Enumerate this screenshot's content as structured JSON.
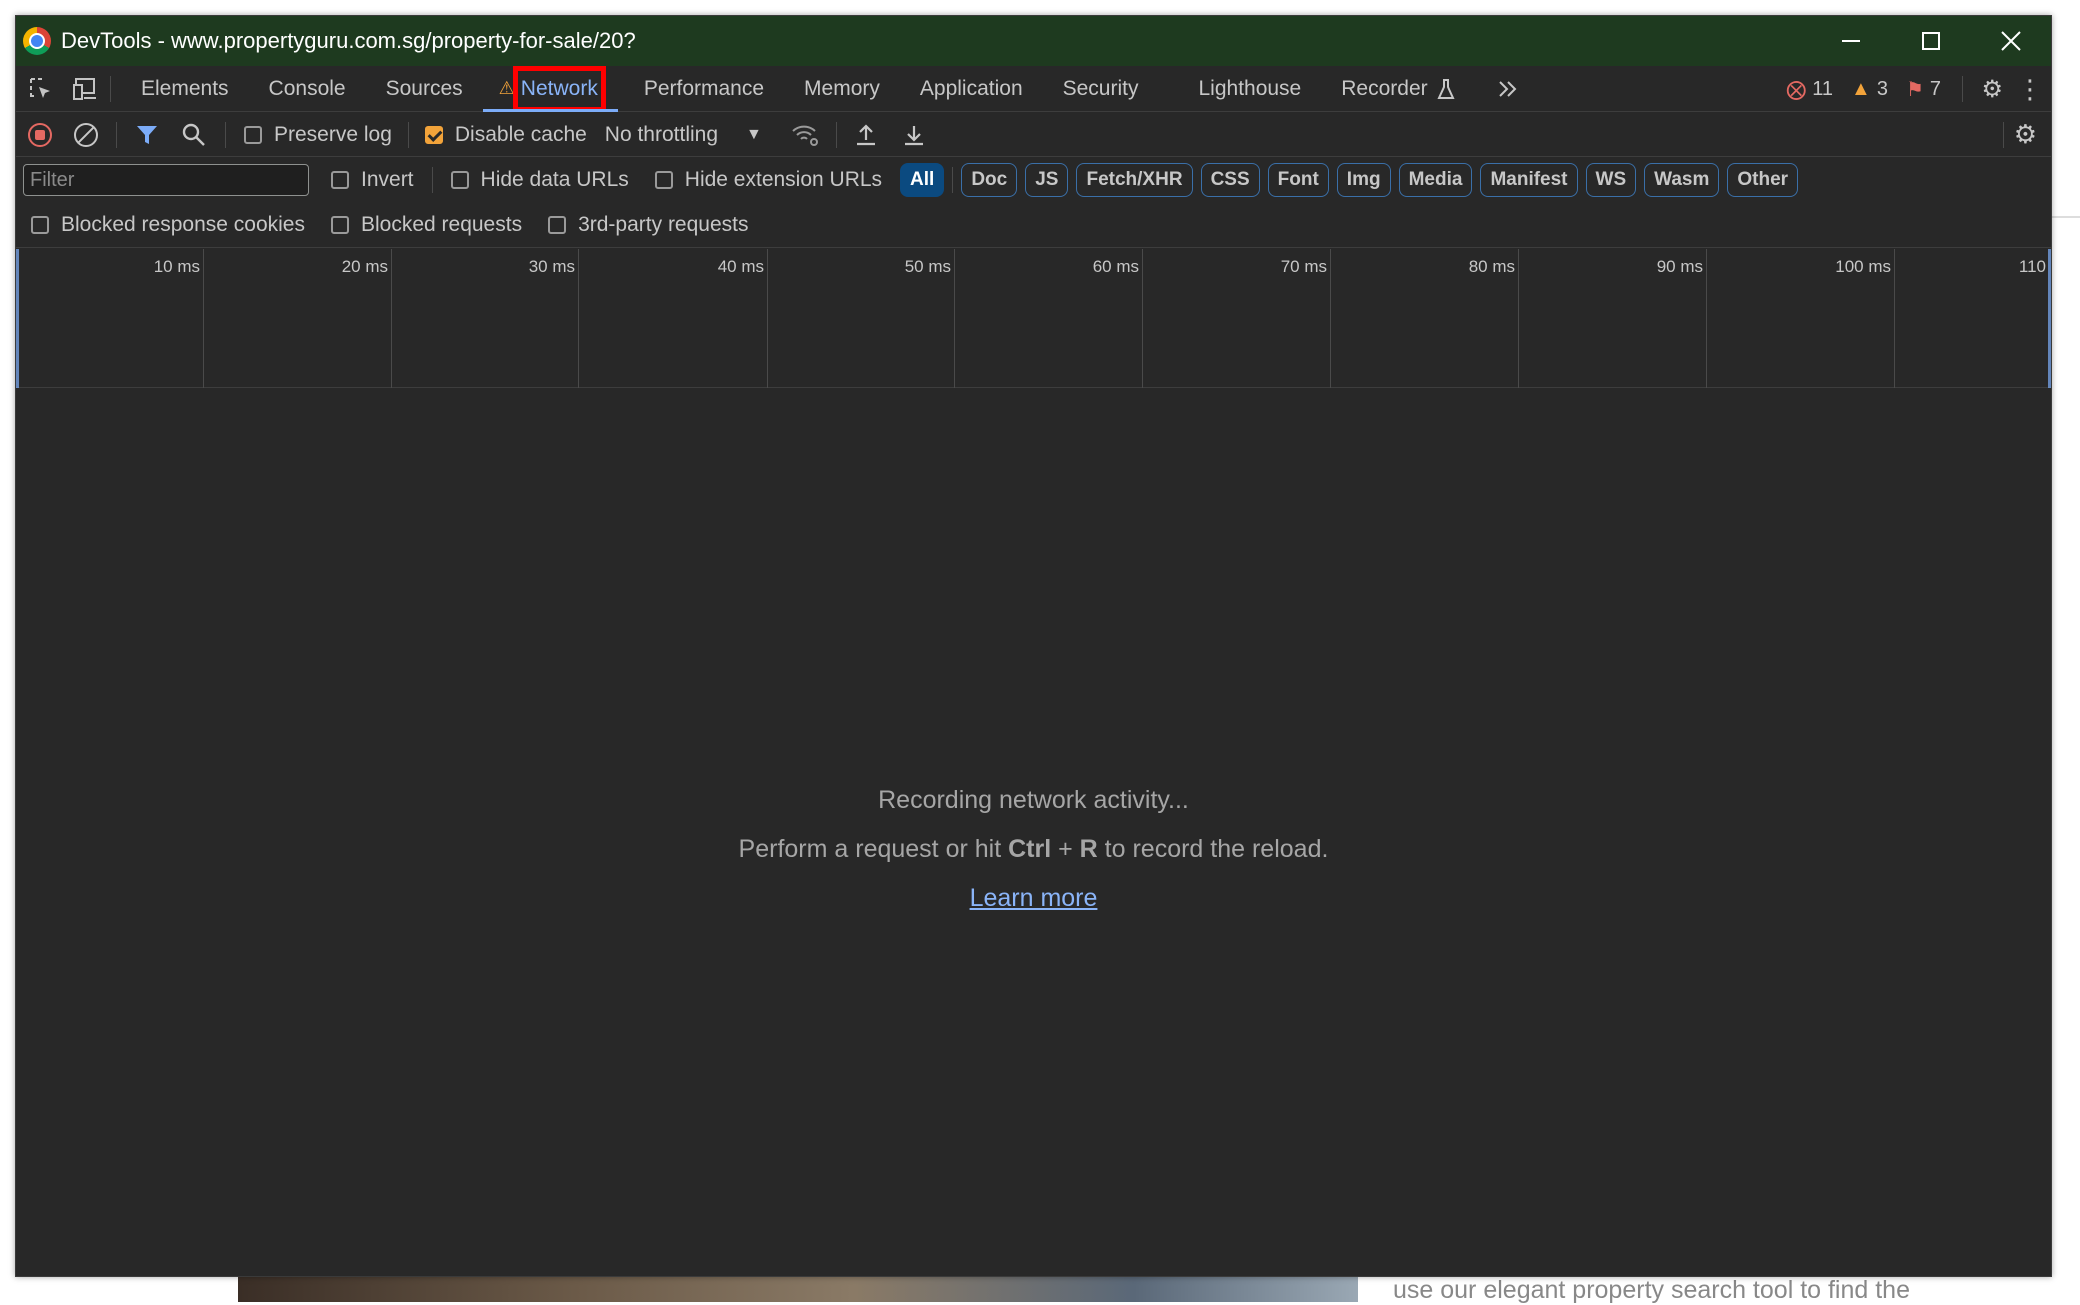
{
  "background": {
    "snippet_text": "use our elegant property search tool to find the"
  },
  "window": {
    "title": "DevTools - www.propertyguru.com.sg/property-for-sale/20?"
  },
  "tabs": [
    {
      "label": "Elements",
      "active": false
    },
    {
      "label": "Console",
      "active": false
    },
    {
      "label": "Sources",
      "active": false
    },
    {
      "label": "Network",
      "active": true,
      "has_warning": true
    },
    {
      "label": "Performance",
      "active": false
    },
    {
      "label": "Memory",
      "active": false
    },
    {
      "label": "Application",
      "active": false
    },
    {
      "label": "Security",
      "active": false
    },
    {
      "label": "Lighthouse",
      "active": false
    },
    {
      "label": "Recorder",
      "active": false
    }
  ],
  "status_counts": {
    "errors": "11",
    "warnings": "3",
    "issues": "7"
  },
  "toolbar": {
    "preserve_log_label": "Preserve log",
    "preserve_log_checked": false,
    "disable_cache_label": "Disable cache",
    "disable_cache_checked": true,
    "throttling_value": "No throttling"
  },
  "filterbar": {
    "filter_placeholder": "Filter",
    "invert_label": "Invert",
    "hide_data_urls_label": "Hide data URLs",
    "hide_extension_urls_label": "Hide extension URLs",
    "chips": [
      "All",
      "Doc",
      "JS",
      "Fetch/XHR",
      "CSS",
      "Font",
      "Img",
      "Media",
      "Manifest",
      "WS",
      "Wasm",
      "Other"
    ],
    "active_chip": "All"
  },
  "options": {
    "blocked_cookies_label": "Blocked response cookies",
    "blocked_requests_label": "Blocked requests",
    "third_party_label": "3rd-party requests"
  },
  "timeline": {
    "ticks": [
      "10 ms",
      "20 ms",
      "30 ms",
      "40 ms",
      "50 ms",
      "60 ms",
      "70 ms",
      "80 ms",
      "90 ms",
      "100 ms",
      "110"
    ]
  },
  "empty_state": {
    "line1": "Recording network activity...",
    "line2_prefix": "Perform a request or hit ",
    "line2_key1": "Ctrl",
    "line2_plus": " + ",
    "line2_key2": "R",
    "line2_suffix": " to record the reload.",
    "learn_more": "Learn more"
  },
  "colors": {
    "accent": "#8ab4f8",
    "error": "#e46962",
    "warning": "#f2a33a",
    "title_bar": "#1e3a1f",
    "panel_bg": "#282828"
  }
}
